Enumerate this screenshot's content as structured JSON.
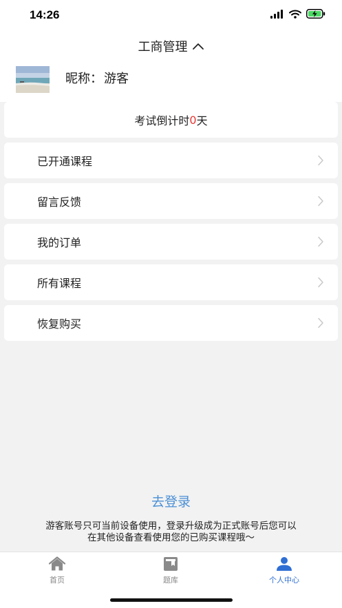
{
  "status_bar": {
    "time": "14:26"
  },
  "header": {
    "title": "工商管理",
    "nickname_label": "昵称：",
    "nickname": "游客"
  },
  "countdown": {
    "prefix": "考试倒计时",
    "days": "0",
    "suffix": "天"
  },
  "menu": [
    {
      "label": "已开通课程"
    },
    {
      "label": "留言反馈"
    },
    {
      "label": "我的订单"
    },
    {
      "label": "所有课程"
    },
    {
      "label": "恢复购买"
    }
  ],
  "login": {
    "link": "去登录",
    "notice_line1": "游客账号只可当前设备使用，登录升级成为正式账号后您可以",
    "notice_line2": "在其他设备查看使用您的已购买课程哦～"
  },
  "tabbar": {
    "tabs": [
      {
        "label": "首页",
        "icon": "home-icon"
      },
      {
        "label": "题库",
        "icon": "question-bank-icon"
      },
      {
        "label": "个人中心",
        "icon": "person-icon",
        "active": true
      }
    ],
    "active_color": "#2f6fd3",
    "inactive_color": "#888888"
  }
}
